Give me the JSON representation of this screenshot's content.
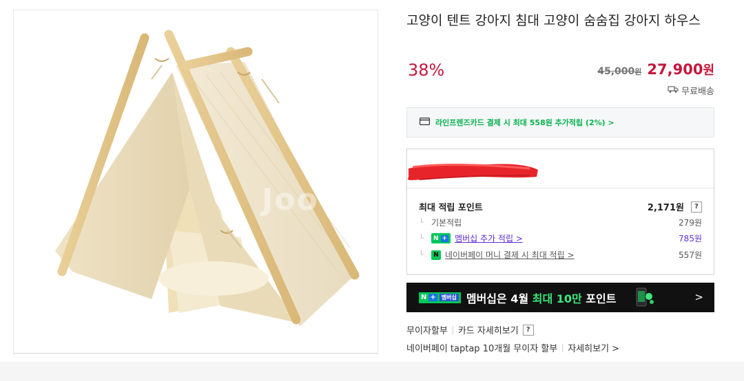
{
  "product": {
    "title": "고양이 텐트 강아지 침대 고양이 숨숨집 강아지 하우스",
    "discount": "38%",
    "original_price": "45,000",
    "original_unit": "원",
    "sale_price": "27,900",
    "sale_unit": "원",
    "shipping": "무료배송",
    "image_watermark": "Joo"
  },
  "card_promo": {
    "text": "라인프렌즈카드 결제 시 최대 558원 추가적립 (2%) >"
  },
  "points": {
    "max_label": "최대 적립 포인트",
    "max_value": "2,171원",
    "help": "?",
    "rows": [
      {
        "label": "기본적립",
        "value": "279원"
      },
      {
        "badge_n": "N",
        "badge_plus": "+",
        "label": "멤버십 추가 적립 >",
        "value": "785원"
      },
      {
        "badge": "N",
        "label": "네이버페이 머니 결제 시 최대 적립 >",
        "value": "557원"
      }
    ]
  },
  "banner": {
    "tag_n": "N",
    "tag_plus": "+",
    "tag_member": "멤버십",
    "text_pre": "멤버십은 4월 ",
    "text_highlight": "최대 10만",
    "text_post": " 포인트",
    "chevron": ">"
  },
  "installment": {
    "row1_a": "무이자할부",
    "row1_b": "카드 자세히보기",
    "row1_help": "?",
    "row2_a": "네이버페이 taptap 10개월 무이자 할부",
    "row2_b": "자세히보기 >"
  },
  "colors": {
    "accent_red": "#c4183c",
    "naver_green": "#03c75a",
    "promo_green": "#05b24c",
    "member_purple": "#5f2dd6"
  }
}
